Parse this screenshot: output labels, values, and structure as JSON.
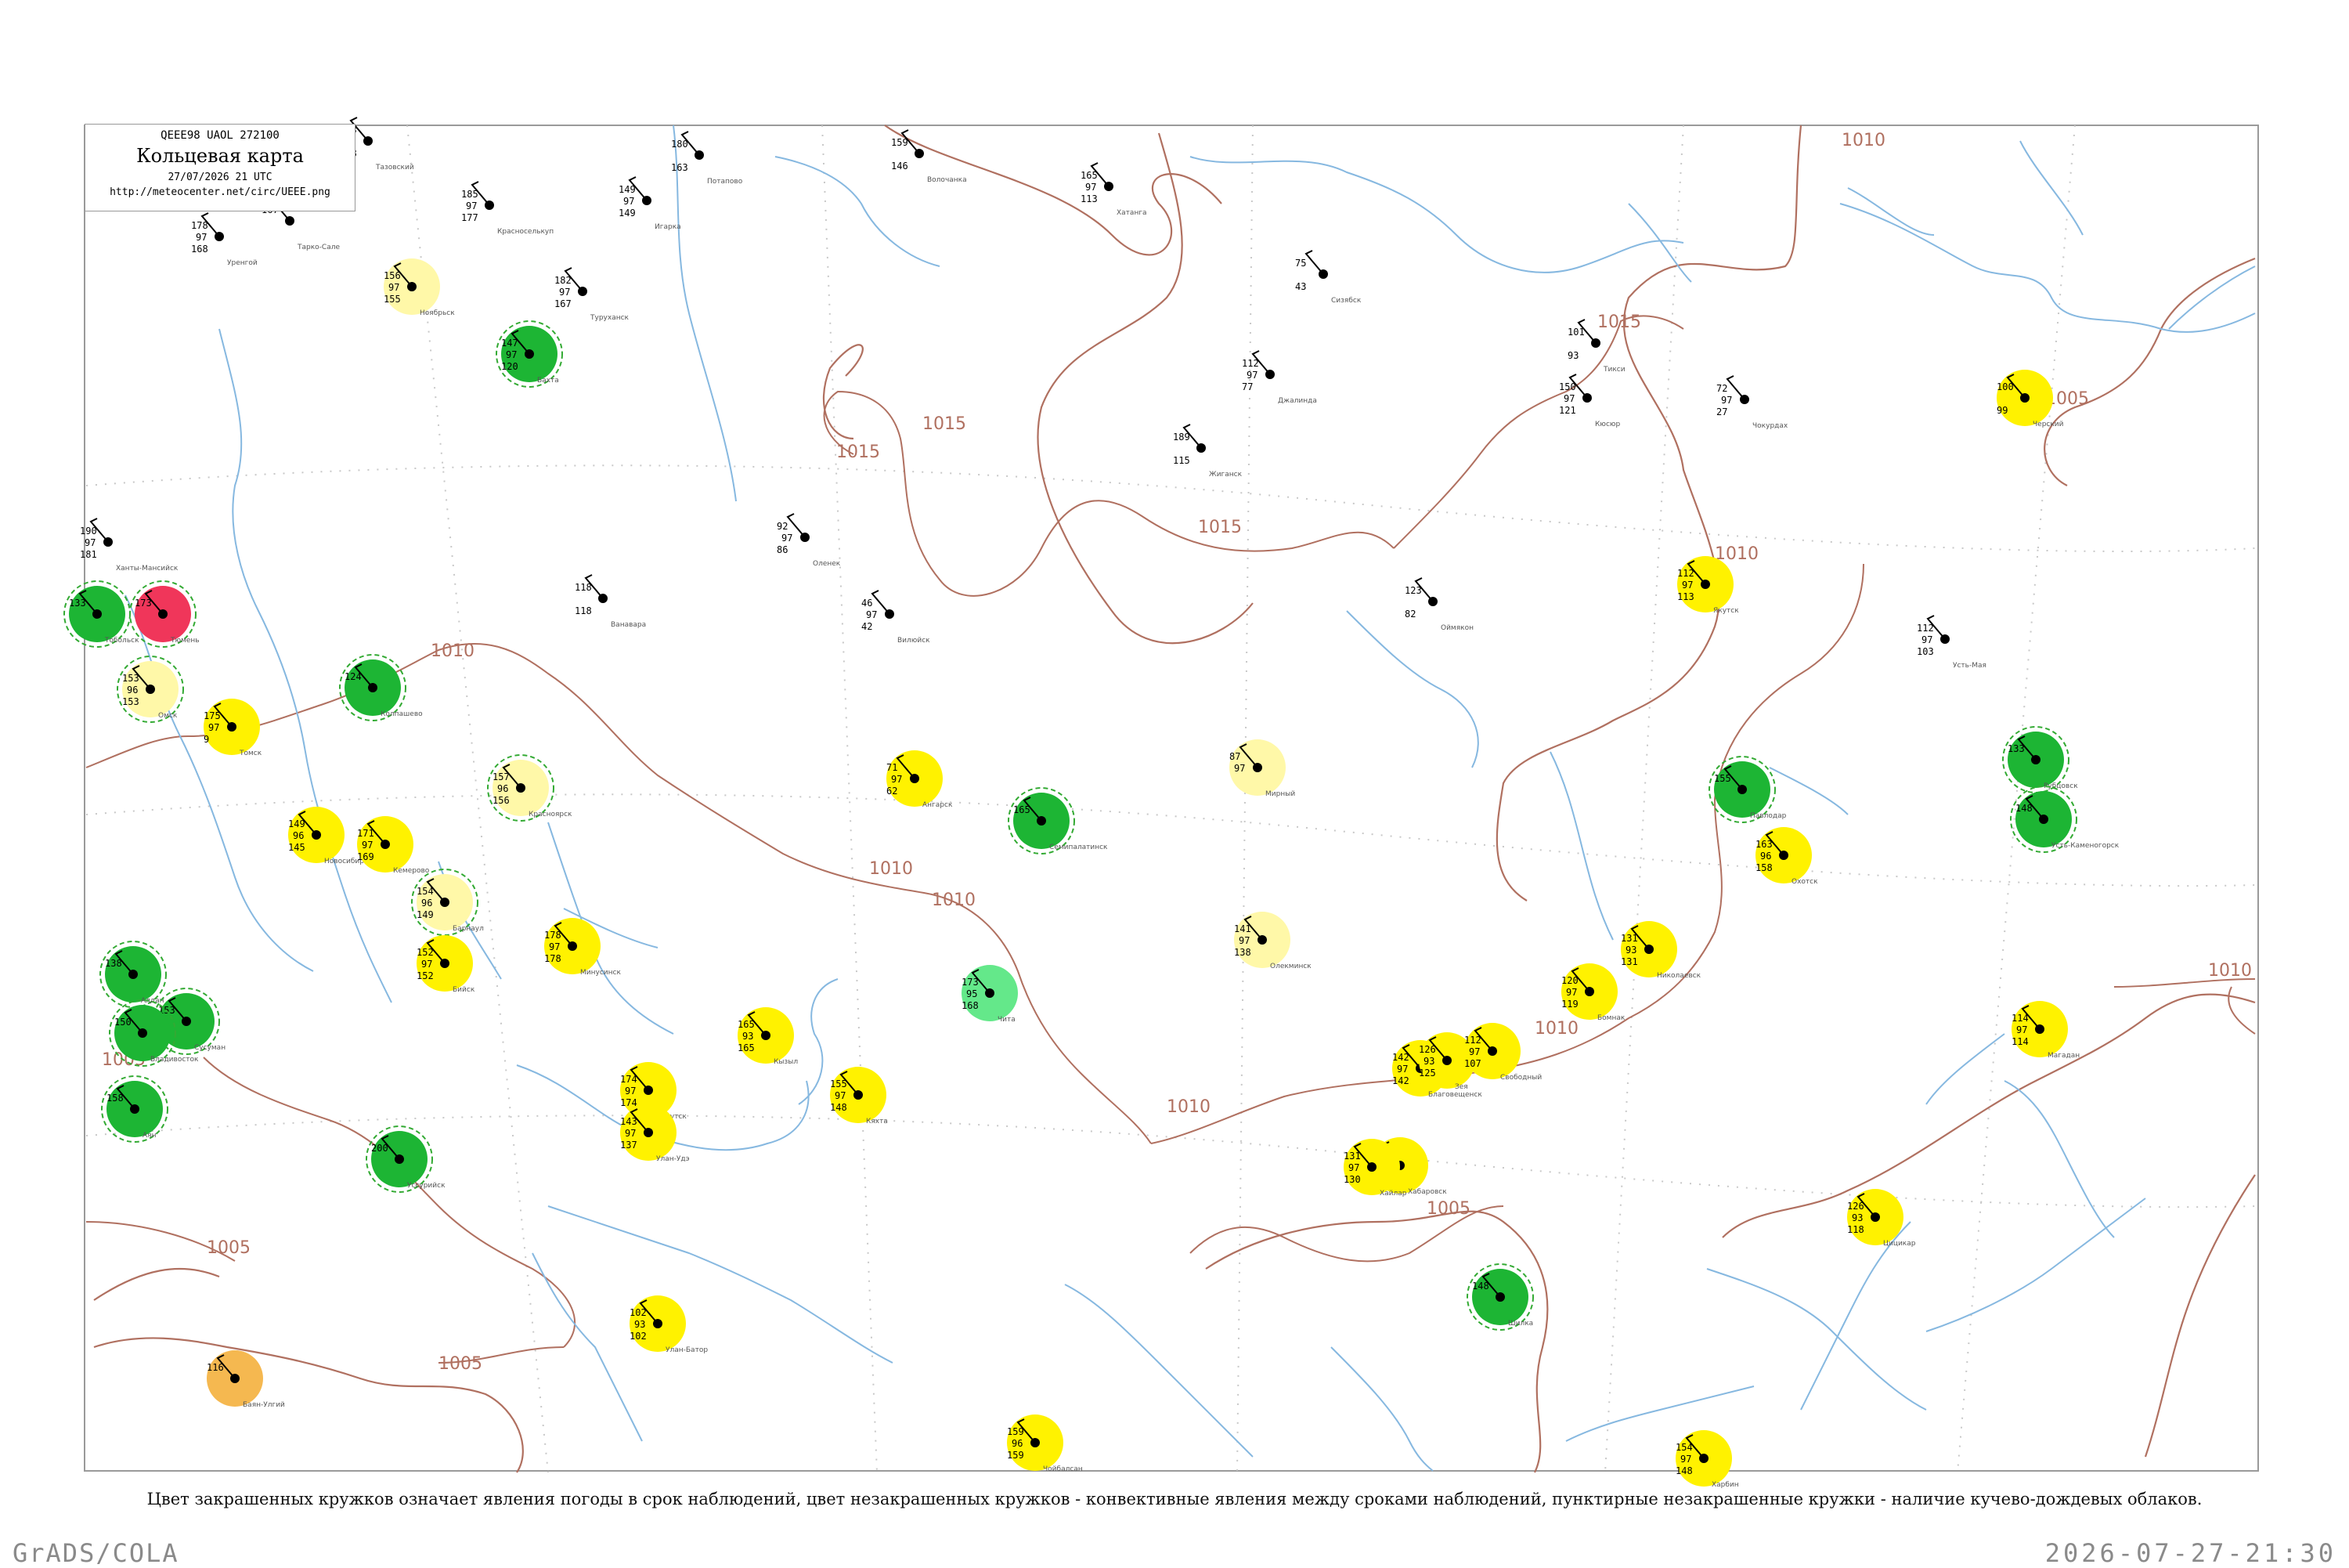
{
  "header": {
    "code": "QEEE98  UAOL  272100",
    "title": "Кольцевая карта",
    "date": "27/07/2026 21 UTC",
    "url": "http://meteocenter.net/circ/UEEE.png"
  },
  "caption": "Цвет закрашенных кружков означает явления погоды в срок наблюдений, цвет незакрашенных кружков - конвективные явления между сроками наблюдений, пунктирные незакрашенные кружки - наличие кучево-дождевых облаков.",
  "footer": {
    "left": "GrADS/COLA",
    "right": "2026-07-27-21:30"
  },
  "colors": {
    "frame": "#9a9a9a",
    "isobar": "#b07060",
    "coast": "#b07060",
    "river": "#86b8e0",
    "green": "#1db534",
    "yellow": "#fff200",
    "paleyellow": "#fff8a8",
    "lightgreen": "#64e88a",
    "red": "#f0365a",
    "orange": "#f5b850",
    "dashgreen": "#33aa33"
  },
  "isobar_labels": [
    "1015",
    "1015",
    "1015",
    "1015",
    "1010",
    "1010",
    "1010",
    "1010",
    "1010",
    "1010",
    "1010",
    "1010",
    "1005",
    "1005",
    "1005",
    "1005",
    "1005"
  ],
  "stations": [
    {
      "name": "Тазовский",
      "pres": "133",
      "t": "97",
      "td": "168",
      "fill": "none",
      "dash": false
    },
    {
      "name": "Тарко-Сале",
      "pres": "167",
      "t": "",
      "td": "",
      "fill": "none",
      "dash": false
    },
    {
      "name": "Уренгой",
      "pres": "178",
      "t": "97",
      "td": "168",
      "fill": "none",
      "dash": false
    },
    {
      "name": "Красноселькуп",
      "pres": "185",
      "t": "97",
      "td": "177",
      "fill": "none",
      "dash": false
    },
    {
      "name": "Игарка",
      "pres": "149",
      "t": "97",
      "td": "149",
      "fill": "none",
      "dash": false
    },
    {
      "name": "Потапово",
      "pres": "180",
      "t": "",
      "td": "163",
      "fill": "none",
      "dash": false
    },
    {
      "name": "Волочанка",
      "pres": "159",
      "t": "",
      "td": "146",
      "fill": "none",
      "dash": false
    },
    {
      "name": "Хатанга",
      "pres": "165",
      "t": "97",
      "td": "113",
      "fill": "none",
      "dash": false
    },
    {
      "name": "Сизябск",
      "pres": "75",
      "t": "",
      "td": "43",
      "fill": "none",
      "dash": false
    },
    {
      "name": "Тикси",
      "pres": "101",
      "t": "",
      "td": "93",
      "fill": "none",
      "dash": false
    },
    {
      "name": "Кюсюр",
      "pres": "150",
      "t": "97",
      "td": "121",
      "fill": "none",
      "dash": false
    },
    {
      "name": "Чокурдах",
      "pres": "72",
      "t": "97",
      "td": "27",
      "fill": "none",
      "dash": false
    },
    {
      "name": "Черский",
      "pres": "100",
      "t": "",
      "td": "99",
      "fill": "yellow",
      "dash": false
    },
    {
      "name": "Ноябрьск",
      "pres": "156",
      "t": "97",
      "td": "155",
      "fill": "paleyellow",
      "dash": false
    },
    {
      "name": "Туруханск",
      "pres": "182",
      "t": "97",
      "td": "167",
      "fill": "none",
      "dash": false
    },
    {
      "name": "Джалинда",
      "pres": "112",
      "t": "97",
      "td": "77",
      "fill": "none",
      "dash": false
    },
    {
      "name": "Бахта",
      "pres": "147",
      "t": "97",
      "td": "120",
      "fill": "green",
      "dash": true
    },
    {
      "name": "Ванавара",
      "pres": "118",
      "t": "",
      "td": "118",
      "fill": "none",
      "dash": false
    },
    {
      "name": "Жиганск",
      "pres": "189",
      "t": "",
      "td": "115",
      "fill": "none",
      "dash": false
    },
    {
      "name": "Оленек",
      "pres": "92",
      "t": "97",
      "td": "86",
      "fill": "none",
      "dash": false
    },
    {
      "name": "Вилюйск",
      "pres": "46",
      "t": "97",
      "td": "42",
      "fill": "none",
      "dash": false
    },
    {
      "name": "Якутск",
      "pres": "112",
      "t": "97",
      "td": "113",
      "fill": "yellow",
      "dash": false
    },
    {
      "name": "Оймякон",
      "pres": "123",
      "t": "",
      "td": "82",
      "fill": "none",
      "dash": false
    },
    {
      "name": "Усть-Мая",
      "pres": "112",
      "t": "97",
      "td": "103",
      "fill": "none",
      "dash": false
    },
    {
      "name": "Ханты-Мансийск",
      "pres": "190",
      "t": "97",
      "td": "181",
      "fill": "none",
      "dash": false
    },
    {
      "name": "Тобольск",
      "pres": "133",
      "t": "",
      "td": "",
      "fill": "green",
      "dash": true
    },
    {
      "name": "Тюмень",
      "pres": "173",
      "t": "",
      "td": "",
      "fill": "red",
      "dash": true
    },
    {
      "name": "Омск",
      "pres": "153",
      "t": "96",
      "td": "153",
      "fill": "paleyellow",
      "dash": true
    },
    {
      "name": "Томск",
      "pres": "175",
      "t": "97",
      "td": "9",
      "fill": "yellow",
      "dash": false
    },
    {
      "name": "Колпашево",
      "pres": "124",
      "t": "",
      "td": "",
      "fill": "green",
      "dash": true
    },
    {
      "name": "Новосибирск",
      "pres": "149",
      "t": "96",
      "td": "145",
      "fill": "yellow",
      "dash": false
    },
    {
      "name": "Кемерово",
      "pres": "171",
      "t": "97",
      "td": "169",
      "fill": "yellow",
      "dash": false
    },
    {
      "name": "Красноярск",
      "pres": "157",
      "t": "96",
      "td": "156",
      "fill": "paleyellow",
      "dash": true
    },
    {
      "name": "Ангарск",
      "pres": "71",
      "t": "97",
      "td": "62",
      "fill": "yellow",
      "dash": false
    },
    {
      "name": "Мирный",
      "pres": "87",
      "t": "97",
      "td": "",
      "fill": "paleyellow",
      "dash": false
    },
    {
      "name": "Олекминск",
      "pres": "141",
      "t": "97",
      "td": "138",
      "fill": "paleyellow",
      "dash": false
    },
    {
      "name": "Чита",
      "pres": "173",
      "t": "95",
      "td": "168",
      "fill": "lightgreen",
      "dash": false
    },
    {
      "name": "Барнаул",
      "pres": "154",
      "t": "96",
      "td": "149",
      "fill": "paleyellow",
      "dash": true
    },
    {
      "name": "Бийск",
      "pres": "152",
      "t": "97",
      "td": "152",
      "fill": "yellow",
      "dash": false
    },
    {
      "name": "Минусинск",
      "pres": "178",
      "t": "97",
      "td": "178",
      "fill": "yellow",
      "dash": false
    },
    {
      "name": "Кызыл",
      "pres": "165",
      "t": "93",
      "td": "165",
      "fill": "yellow",
      "dash": false
    },
    {
      "name": "Иркутск",
      "pres": "174",
      "t": "97",
      "td": "174",
      "fill": "yellow",
      "dash": false
    },
    {
      "name": "Улан-Удэ",
      "pres": "143",
      "t": "97",
      "td": "137",
      "fill": "yellow",
      "dash": false
    },
    {
      "name": "Кяхта",
      "pres": "155",
      "t": "97",
      "td": "148",
      "fill": "yellow",
      "dash": false
    },
    {
      "name": "Хабаровск",
      "pres": "131",
      "t": "93",
      "td": "",
      "fill": "yellow",
      "dash": false
    },
    {
      "name": "Благовещенск",
      "pres": "142",
      "t": "97",
      "td": "142",
      "fill": "yellow",
      "dash": false
    },
    {
      "name": "Зея",
      "pres": "126",
      "t": "93",
      "td": "125",
      "fill": "yellow",
      "dash": false
    },
    {
      "name": "Свободный",
      "pres": "112",
      "t": "97",
      "td": "107",
      "fill": "yellow",
      "dash": false
    },
    {
      "name": "Бомнак",
      "pres": "120",
      "t": "97",
      "td": "119",
      "fill": "yellow",
      "dash": false
    },
    {
      "name": "Николаевск",
      "pres": "131",
      "t": "93",
      "td": "131",
      "fill": "yellow",
      "dash": false
    },
    {
      "name": "Охотск",
      "pres": "163",
      "t": "96",
      "td": "158",
      "fill": "yellow",
      "dash": false
    },
    {
      "name": "Магадан",
      "pres": "114",
      "t": "97",
      "td": "114",
      "fill": "yellow",
      "dash": false
    },
    {
      "name": "Хайлар",
      "pres": "131",
      "t": "97",
      "td": "130",
      "fill": "yellow",
      "dash": false
    },
    {
      "name": "Цицикар",
      "pres": "126",
      "t": "93",
      "td": "118",
      "fill": "yellow",
      "dash": false
    },
    {
      "name": "Харбин",
      "pres": "154",
      "t": "97",
      "td": "148",
      "fill": "yellow",
      "dash": false
    },
    {
      "name": "Улан-Батор",
      "pres": "102",
      "t": "93",
      "td": "102",
      "fill": "yellow",
      "dash": false
    },
    {
      "name": "Чойбалсан",
      "pres": "159",
      "t": "96",
      "td": "159",
      "fill": "yellow",
      "dash": false
    },
    {
      "name": "Баян-Улгий",
      "pres": "116",
      "t": "",
      "td": "",
      "fill": "orange",
      "dash": false
    },
    {
      "name": "Павлодар",
      "pres": "155",
      "t": "",
      "td": "",
      "fill": "green",
      "dash": true
    },
    {
      "name": "Семипалатинск",
      "pres": "165",
      "t": "",
      "td": "",
      "fill": "green",
      "dash": true
    },
    {
      "name": "Рубцовск",
      "pres": "133",
      "t": "",
      "td": "",
      "fill": "green",
      "dash": true
    },
    {
      "name": "Усть-Каменогорск",
      "pres": "148",
      "t": "",
      "td": "",
      "fill": "green",
      "dash": true
    },
    {
      "name": "Аян",
      "pres": "158",
      "t": "",
      "td": "",
      "fill": "green",
      "dash": true
    },
    {
      "name": "Алдан",
      "pres": "138",
      "t": "",
      "td": "",
      "fill": "green",
      "dash": true
    },
    {
      "name": "Сусуман",
      "pres": "153",
      "t": "",
      "td": "",
      "fill": "green",
      "dash": true
    },
    {
      "name": "Владивосток",
      "pres": "150",
      "t": "",
      "td": "",
      "fill": "green",
      "dash": true
    },
    {
      "name": "Уссурийск",
      "pres": "200",
      "t": "",
      "td": "",
      "fill": "green",
      "dash": true
    },
    {
      "name": "Шилка",
      "pres": "148",
      "t": "",
      "td": "",
      "fill": "green",
      "dash": true
    }
  ]
}
